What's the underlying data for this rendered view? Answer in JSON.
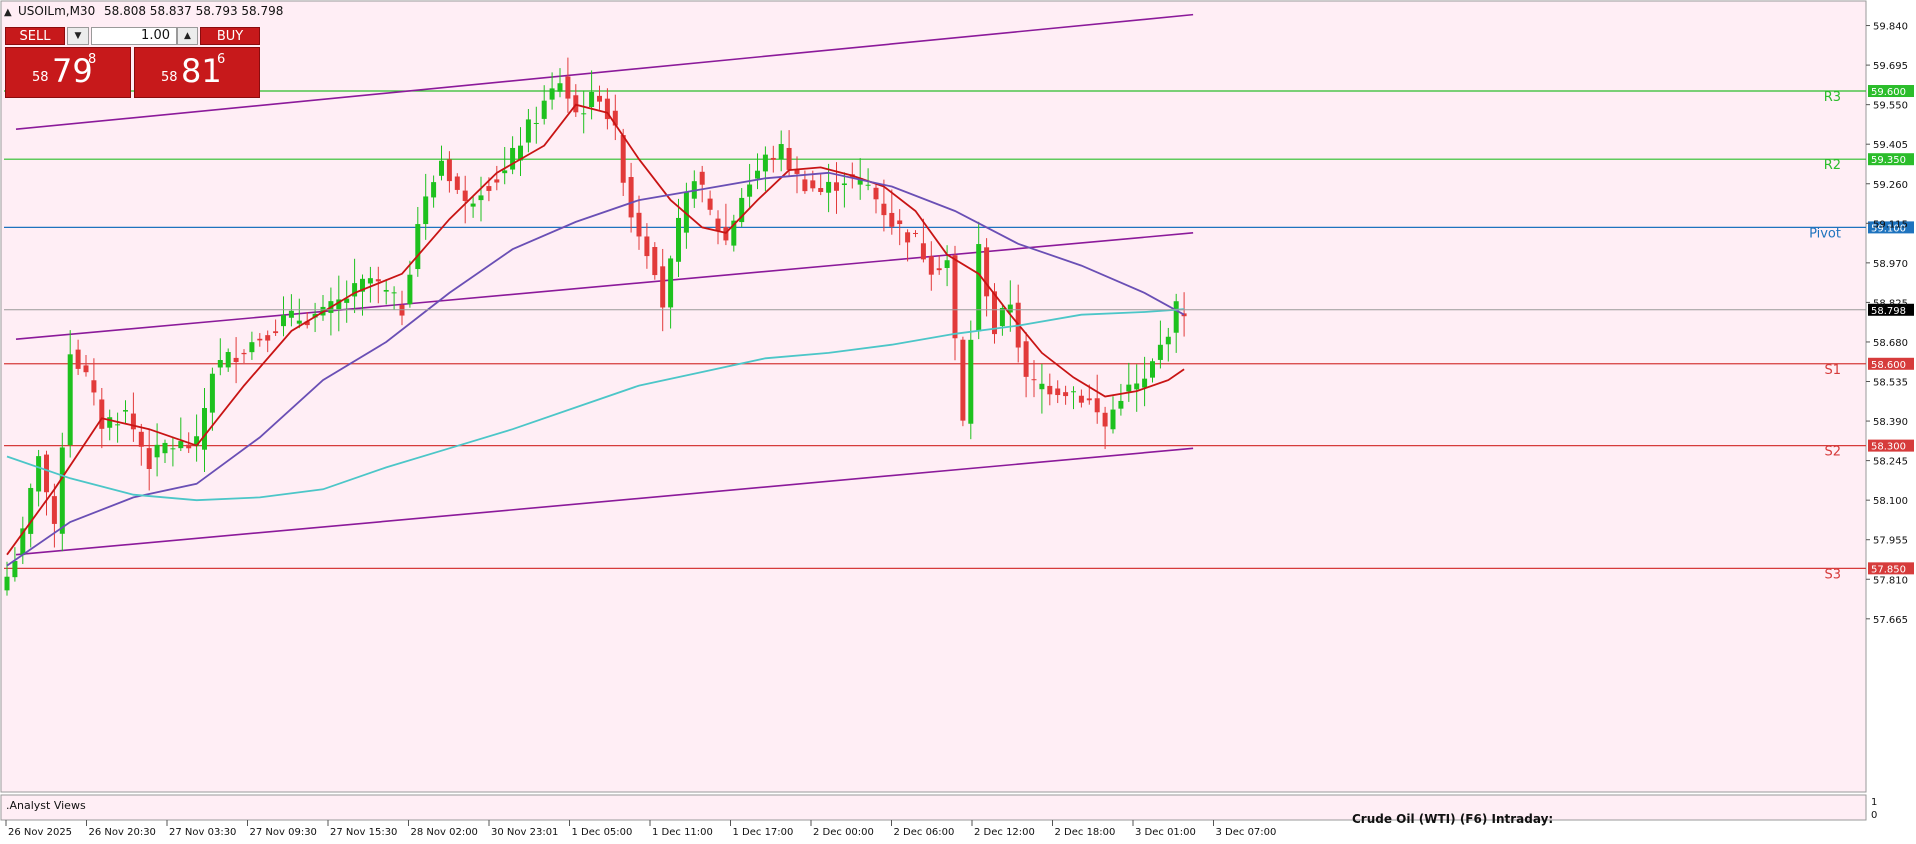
{
  "header": {
    "menu_icon": "triangle-up-icon",
    "symbol": "USOILm,M30",
    "ohlc": "58.808 58.837 58.793 58.798"
  },
  "trade_panel": {
    "sell_label": "SELL",
    "buy_label": "BUY",
    "lot": "1.00",
    "sell_price": {
      "prefix": "58",
      "big": "79",
      "sup": "8"
    },
    "buy_price": {
      "prefix": "58",
      "big": "81",
      "sup": "6"
    }
  },
  "indicator_panel": {
    "label": ".Analyst Views",
    "title": "Crude Oil (WTI) (F6) Intraday:",
    "scale_top": "1",
    "scale_bottom": "0"
  },
  "current_price": {
    "value": 58.798,
    "label": "58.798"
  },
  "colors": {
    "background": "#ffeef5",
    "bull": "#1ec11e",
    "bear": "#e23a3a",
    "pivot": "#1e73be",
    "resistance": "#2bbd2b",
    "support": "#d63b3b",
    "channel": "#8b1a9a",
    "ma_fast": "#c81414",
    "ma_mid": "#6a4fb5",
    "ma_slow": "#4cc6c8"
  },
  "chart_data": {
    "type": "candlestick",
    "timeframe": "M30",
    "y_range": [
      57.58,
      59.93
    ],
    "y_ticks": [
      "59.840",
      "59.695",
      "59.550",
      "59.405",
      "59.260",
      "59.115",
      "58.970",
      "58.825",
      "58.680",
      "58.535",
      "58.390",
      "58.245",
      "58.100",
      "57.955",
      "57.810",
      "57.665"
    ],
    "x_ticks": [
      "26 Nov 2025",
      "26 Nov 20:30",
      "27 Nov 03:30",
      "27 Nov 09:30",
      "27 Nov 15:30",
      "28 Nov 02:00",
      "30 Nov 23:01",
      "1 Dec 05:00",
      "1 Dec 11:00",
      "1 Dec 17:00",
      "2 Dec 00:00",
      "2 Dec 06:00",
      "2 Dec 12:00",
      "2 Dec 18:00",
      "3 Dec 01:00",
      "3 Dec 07:00"
    ],
    "levels": [
      {
        "name": "R3",
        "value": 59.6,
        "label": "59.600"
      },
      {
        "name": "R2",
        "value": 59.35,
        "label": "59.350"
      },
      {
        "name": "Pivot",
        "value": 59.1,
        "label": "59.100"
      },
      {
        "name": "S1",
        "value": 58.6,
        "label": "58.600"
      },
      {
        "name": "S2",
        "value": 58.3,
        "label": "58.300"
      },
      {
        "name": "S3",
        "value": 57.85,
        "label": "57.850"
      }
    ],
    "channel_lines": [
      {
        "start": [
          0,
          59.46
        ],
        "end": [
          149,
          59.88
        ]
      },
      {
        "start": [
          0,
          58.69
        ],
        "end": [
          149,
          59.08
        ]
      },
      {
        "start": [
          0,
          57.9
        ],
        "end": [
          149,
          58.29
        ]
      }
    ],
    "candle_path": [
      [
        0,
        57.82
      ],
      [
        2,
        57.97
      ],
      [
        4,
        58.28
      ],
      [
        6,
        57.98
      ],
      [
        8,
        58.65
      ],
      [
        10,
        58.55
      ],
      [
        12,
        58.38
      ],
      [
        15,
        58.42
      ],
      [
        18,
        58.24
      ],
      [
        20,
        58.3
      ],
      [
        24,
        58.3
      ],
      [
        26,
        58.58
      ],
      [
        30,
        58.66
      ],
      [
        35,
        58.76
      ],
      [
        40,
        58.78
      ],
      [
        46,
        58.91
      ],
      [
        50,
        58.8
      ],
      [
        52,
        59.12
      ],
      [
        55,
        59.35
      ],
      [
        58,
        59.18
      ],
      [
        60,
        59.25
      ],
      [
        63,
        59.3
      ],
      [
        65,
        59.42
      ],
      [
        68,
        59.55
      ],
      [
        70,
        59.64
      ],
      [
        72,
        59.52
      ],
      [
        75,
        59.59
      ],
      [
        77,
        59.44
      ],
      [
        79,
        59.15
      ],
      [
        82,
        58.96
      ],
      [
        83,
        58.82
      ],
      [
        85,
        59.1
      ],
      [
        87,
        59.3
      ],
      [
        89,
        59.15
      ],
      [
        91,
        59.05
      ],
      [
        93,
        59.22
      ],
      [
        96,
        59.35
      ],
      [
        98,
        59.38
      ],
      [
        100,
        59.28
      ],
      [
        103,
        59.23
      ],
      [
        106,
        59.28
      ],
      [
        109,
        59.25
      ],
      [
        112,
        59.12
      ],
      [
        115,
        59.05
      ],
      [
        117,
        58.96
      ],
      [
        119,
        58.98
      ],
      [
        121,
        58.38
      ],
      [
        123,
        59.02
      ],
      [
        125,
        58.72
      ],
      [
        127,
        58.83
      ],
      [
        129,
        58.53
      ],
      [
        131,
        58.52
      ],
      [
        135,
        58.5
      ],
      [
        137,
        58.46
      ],
      [
        139,
        58.37
      ],
      [
        141,
        58.49
      ],
      [
        144,
        58.53
      ],
      [
        146,
        58.66
      ],
      [
        148,
        58.8
      ],
      [
        149,
        58.8
      ]
    ],
    "moving_averages": [
      {
        "name": "fast",
        "points": [
          [
            0,
            57.9
          ],
          [
            6,
            58.14
          ],
          [
            12,
            58.4
          ],
          [
            18,
            58.36
          ],
          [
            24,
            58.3
          ],
          [
            30,
            58.52
          ],
          [
            36,
            58.72
          ],
          [
            44,
            58.86
          ],
          [
            50,
            58.93
          ],
          [
            56,
            59.13
          ],
          [
            62,
            59.3
          ],
          [
            68,
            59.4
          ],
          [
            72,
            59.55
          ],
          [
            76,
            59.52
          ],
          [
            80,
            59.35
          ],
          [
            84,
            59.2
          ],
          [
            88,
            59.1
          ],
          [
            91,
            59.08
          ],
          [
            95,
            59.2
          ],
          [
            99,
            59.31
          ],
          [
            103,
            59.32
          ],
          [
            107,
            59.29
          ],
          [
            111,
            59.25
          ],
          [
            115,
            59.16
          ],
          [
            119,
            59.0
          ],
          [
            123,
            58.93
          ],
          [
            127,
            58.78
          ],
          [
            131,
            58.64
          ],
          [
            135,
            58.55
          ],
          [
            139,
            58.48
          ],
          [
            143,
            58.5
          ],
          [
            147,
            58.54
          ],
          [
            149,
            58.58
          ]
        ]
      },
      {
        "name": "mid",
        "points": [
          [
            0,
            57.86
          ],
          [
            8,
            58.02
          ],
          [
            16,
            58.11
          ],
          [
            24,
            58.16
          ],
          [
            32,
            58.33
          ],
          [
            40,
            58.54
          ],
          [
            48,
            58.68
          ],
          [
            56,
            58.86
          ],
          [
            64,
            59.02
          ],
          [
            72,
            59.12
          ],
          [
            80,
            59.2
          ],
          [
            88,
            59.24
          ],
          [
            96,
            59.28
          ],
          [
            104,
            59.3
          ],
          [
            112,
            59.25
          ],
          [
            120,
            59.16
          ],
          [
            128,
            59.04
          ],
          [
            136,
            58.96
          ],
          [
            144,
            58.86
          ],
          [
            149,
            58.78
          ]
        ]
      },
      {
        "name": "slow",
        "points": [
          [
            0,
            58.26
          ],
          [
            8,
            58.18
          ],
          [
            16,
            58.12
          ],
          [
            24,
            58.1
          ],
          [
            32,
            58.11
          ],
          [
            40,
            58.14
          ],
          [
            48,
            58.22
          ],
          [
            56,
            58.29
          ],
          [
            64,
            58.36
          ],
          [
            72,
            58.44
          ],
          [
            80,
            58.52
          ],
          [
            88,
            58.57
          ],
          [
            96,
            58.62
          ],
          [
            104,
            58.64
          ],
          [
            112,
            58.67
          ],
          [
            120,
            58.71
          ],
          [
            128,
            58.74
          ],
          [
            136,
            58.78
          ],
          [
            144,
            58.79
          ],
          [
            149,
            58.8
          ]
        ]
      }
    ]
  }
}
